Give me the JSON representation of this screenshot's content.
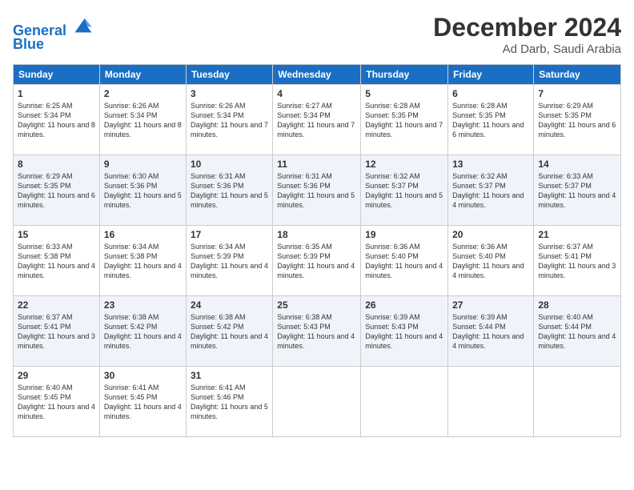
{
  "header": {
    "logo_line1": "General",
    "logo_line2": "Blue",
    "month": "December 2024",
    "location": "Ad Darb, Saudi Arabia"
  },
  "days_of_week": [
    "Sunday",
    "Monday",
    "Tuesday",
    "Wednesday",
    "Thursday",
    "Friday",
    "Saturday"
  ],
  "weeks": [
    [
      {
        "day": "1",
        "sunrise": "6:25 AM",
        "sunset": "5:34 PM",
        "daylight": "11 hours and 8 minutes."
      },
      {
        "day": "2",
        "sunrise": "6:26 AM",
        "sunset": "5:34 PM",
        "daylight": "11 hours and 8 minutes."
      },
      {
        "day": "3",
        "sunrise": "6:26 AM",
        "sunset": "5:34 PM",
        "daylight": "11 hours and 7 minutes."
      },
      {
        "day": "4",
        "sunrise": "6:27 AM",
        "sunset": "5:34 PM",
        "daylight": "11 hours and 7 minutes."
      },
      {
        "day": "5",
        "sunrise": "6:28 AM",
        "sunset": "5:35 PM",
        "daylight": "11 hours and 7 minutes."
      },
      {
        "day": "6",
        "sunrise": "6:28 AM",
        "sunset": "5:35 PM",
        "daylight": "11 hours and 6 minutes."
      },
      {
        "day": "7",
        "sunrise": "6:29 AM",
        "sunset": "5:35 PM",
        "daylight": "11 hours and 6 minutes."
      }
    ],
    [
      {
        "day": "8",
        "sunrise": "6:29 AM",
        "sunset": "5:35 PM",
        "daylight": "11 hours and 6 minutes."
      },
      {
        "day": "9",
        "sunrise": "6:30 AM",
        "sunset": "5:36 PM",
        "daylight": "11 hours and 5 minutes."
      },
      {
        "day": "10",
        "sunrise": "6:31 AM",
        "sunset": "5:36 PM",
        "daylight": "11 hours and 5 minutes."
      },
      {
        "day": "11",
        "sunrise": "6:31 AM",
        "sunset": "5:36 PM",
        "daylight": "11 hours and 5 minutes."
      },
      {
        "day": "12",
        "sunrise": "6:32 AM",
        "sunset": "5:37 PM",
        "daylight": "11 hours and 5 minutes."
      },
      {
        "day": "13",
        "sunrise": "6:32 AM",
        "sunset": "5:37 PM",
        "daylight": "11 hours and 4 minutes."
      },
      {
        "day": "14",
        "sunrise": "6:33 AM",
        "sunset": "5:37 PM",
        "daylight": "11 hours and 4 minutes."
      }
    ],
    [
      {
        "day": "15",
        "sunrise": "6:33 AM",
        "sunset": "5:38 PM",
        "daylight": "11 hours and 4 minutes."
      },
      {
        "day": "16",
        "sunrise": "6:34 AM",
        "sunset": "5:38 PM",
        "daylight": "11 hours and 4 minutes."
      },
      {
        "day": "17",
        "sunrise": "6:34 AM",
        "sunset": "5:39 PM",
        "daylight": "11 hours and 4 minutes."
      },
      {
        "day": "18",
        "sunrise": "6:35 AM",
        "sunset": "5:39 PM",
        "daylight": "11 hours and 4 minutes."
      },
      {
        "day": "19",
        "sunrise": "6:36 AM",
        "sunset": "5:40 PM",
        "daylight": "11 hours and 4 minutes."
      },
      {
        "day": "20",
        "sunrise": "6:36 AM",
        "sunset": "5:40 PM",
        "daylight": "11 hours and 4 minutes."
      },
      {
        "day": "21",
        "sunrise": "6:37 AM",
        "sunset": "5:41 PM",
        "daylight": "11 hours and 3 minutes."
      }
    ],
    [
      {
        "day": "22",
        "sunrise": "6:37 AM",
        "sunset": "5:41 PM",
        "daylight": "11 hours and 3 minutes."
      },
      {
        "day": "23",
        "sunrise": "6:38 AM",
        "sunset": "5:42 PM",
        "daylight": "11 hours and 4 minutes."
      },
      {
        "day": "24",
        "sunrise": "6:38 AM",
        "sunset": "5:42 PM",
        "daylight": "11 hours and 4 minutes."
      },
      {
        "day": "25",
        "sunrise": "6:38 AM",
        "sunset": "5:43 PM",
        "daylight": "11 hours and 4 minutes."
      },
      {
        "day": "26",
        "sunrise": "6:39 AM",
        "sunset": "5:43 PM",
        "daylight": "11 hours and 4 minutes."
      },
      {
        "day": "27",
        "sunrise": "6:39 AM",
        "sunset": "5:44 PM",
        "daylight": "11 hours and 4 minutes."
      },
      {
        "day": "28",
        "sunrise": "6:40 AM",
        "sunset": "5:44 PM",
        "daylight": "11 hours and 4 minutes."
      }
    ],
    [
      {
        "day": "29",
        "sunrise": "6:40 AM",
        "sunset": "5:45 PM",
        "daylight": "11 hours and 4 minutes."
      },
      {
        "day": "30",
        "sunrise": "6:41 AM",
        "sunset": "5:45 PM",
        "daylight": "11 hours and 4 minutes."
      },
      {
        "day": "31",
        "sunrise": "6:41 AM",
        "sunset": "5:46 PM",
        "daylight": "11 hours and 5 minutes."
      },
      null,
      null,
      null,
      null
    ]
  ]
}
